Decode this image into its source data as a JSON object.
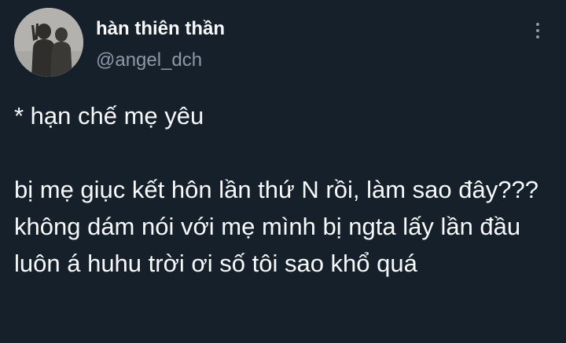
{
  "user": {
    "display_name": "hàn thiên thần",
    "handle": "@angel_dch",
    "avatar_icon": "avatar-photo-silhouette"
  },
  "tweet": {
    "line1": "* hạn chế mẹ yêu",
    "line2": "bị mẹ giục kết hôn lần thứ N rồi, làm sao đây???",
    "line3": "không dám nói với mẹ mình bị ngta lấy lần đầu luôn á huhu trời ơi số tôi sao khổ quá"
  },
  "icons": {
    "more": "more-vertical-icon"
  },
  "colors": {
    "background": "#15202b",
    "text_primary": "#f7f9f9",
    "text_secondary": "#8b98a5"
  }
}
